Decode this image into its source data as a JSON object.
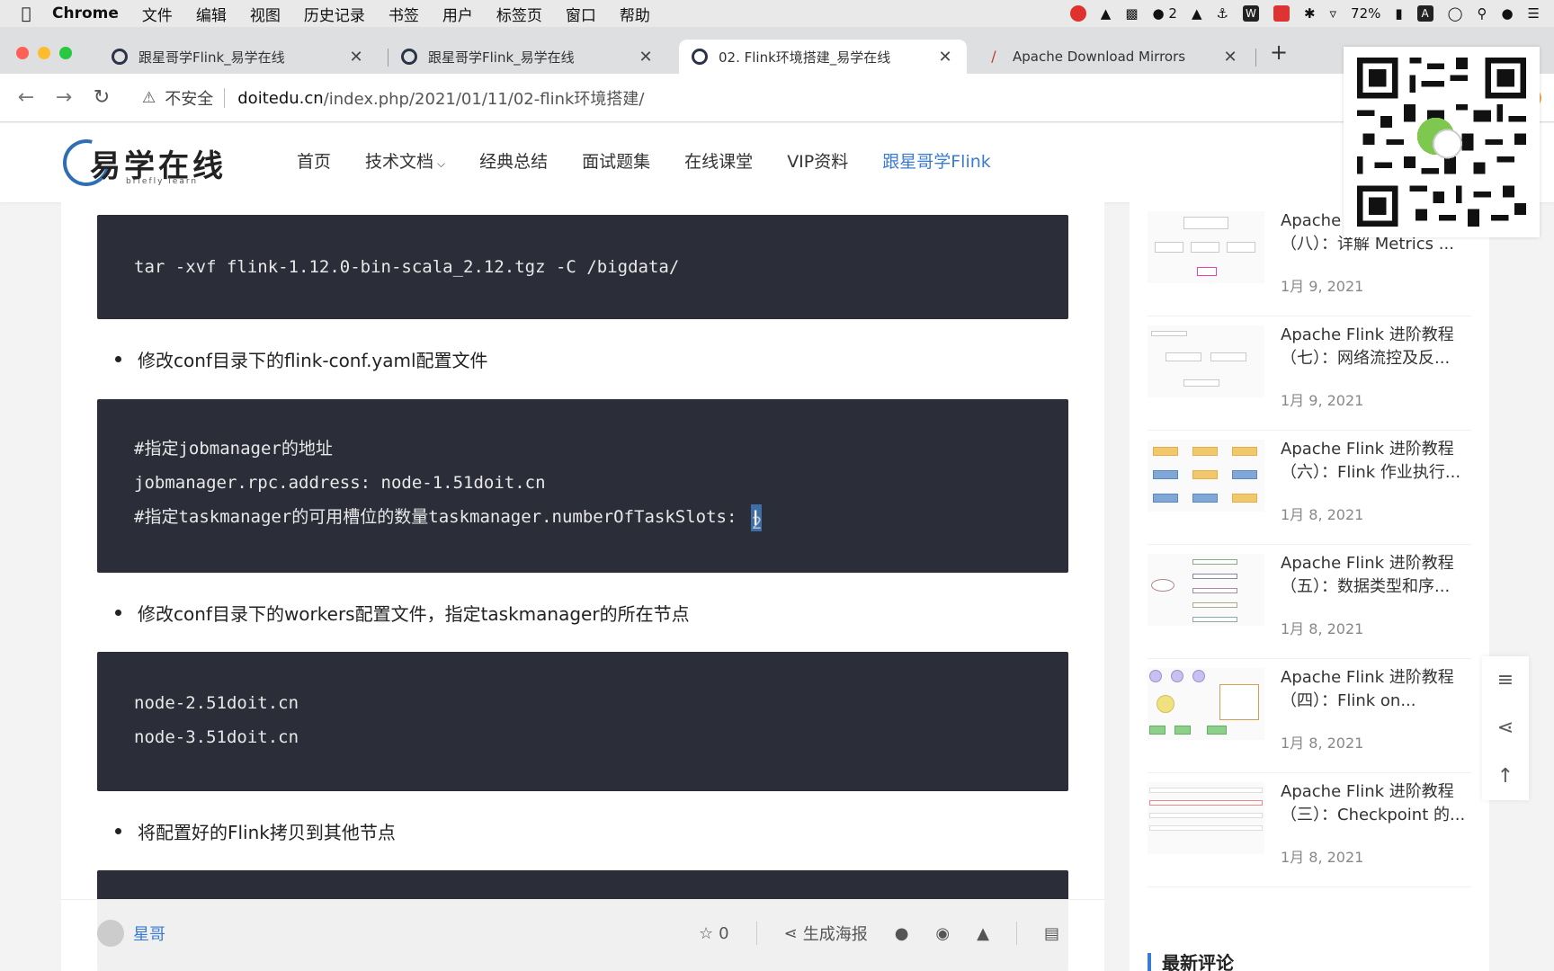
{
  "menubar": {
    "app_name": "Chrome",
    "items": [
      "文件",
      "编辑",
      "视图",
      "历史记录",
      "书签",
      "用户",
      "标签页",
      "窗口",
      "帮助"
    ],
    "notification_count": "2",
    "battery": "72%"
  },
  "tabs": [
    {
      "title": "跟星哥学Flink_易学在线"
    },
    {
      "title": "跟星哥学Flink_易学在线"
    },
    {
      "title": "02. Flink环境搭建_易学在线"
    },
    {
      "title": "Apache Download Mirrors"
    }
  ],
  "address": {
    "security_label": "不安全",
    "host": "doitedu.cn",
    "path": "/index.php/2021/01/11/02-flink环境搭建/"
  },
  "site": {
    "logo_text": "易学在线",
    "logo_sub": "briefly learn",
    "nav": [
      "首页",
      "技术文档",
      "经典总结",
      "面试题集",
      "在线课堂",
      "VIP资料",
      "跟星哥学Flink"
    ]
  },
  "article": {
    "code1": [
      "tar -xvf flink-1.12.0-bin-scala_2.12.tgz -C /bigdata/"
    ],
    "bullet1": "修改conf目录下的flink-conf.yaml配置文件",
    "code2": [
      "#指定jobmanager的地址",
      "jobmanager.rpc.address: node-1.51doit.cn",
      "#指定taskmanager的可用槽位的数量taskmanager.numberOfTaskSlots: "
    ],
    "code2_selected": "2",
    "bullet2": "修改conf目录下的workers配置文件，指定taskmanager的所在节点",
    "code3": [
      "node-2.51doit.cn",
      "node-3.51doit.cn"
    ],
    "bullet3": "将配置好的Flink拷贝到其他节点"
  },
  "postbar": {
    "author": "星哥",
    "likes": "0",
    "poster_label": "生成海报"
  },
  "sidebar": {
    "posts": [
      {
        "title1": "Apache Flink 进阶教程",
        "title2": "（八）：详解 Metrics ...",
        "date": "1月 9, 2021"
      },
      {
        "title1": "Apache Flink 进阶教程",
        "title2": "（七）：网络流控及反...",
        "date": "1月 9, 2021"
      },
      {
        "title1": "Apache Flink 进阶教程",
        "title2": "（六）：Flink 作业执行...",
        "date": "1月 8, 2021"
      },
      {
        "title1": "Apache Flink 进阶教程",
        "title2": "（五）：数据类型和序...",
        "date": "1月 8, 2021"
      },
      {
        "title1": "Apache Flink 进阶教程",
        "title2": "（四）：Flink on...",
        "date": "1月 8, 2021"
      },
      {
        "title1": "Apache Flink 进阶教程",
        "title2": "（三）：Checkpoint 的...",
        "date": "1月 8, 2021"
      }
    ],
    "latest_comments": "最新评论"
  },
  "colors": {
    "accent": "#3a7bd5",
    "code_bg": "#2b2d38",
    "selection": "#3d6ea8"
  }
}
